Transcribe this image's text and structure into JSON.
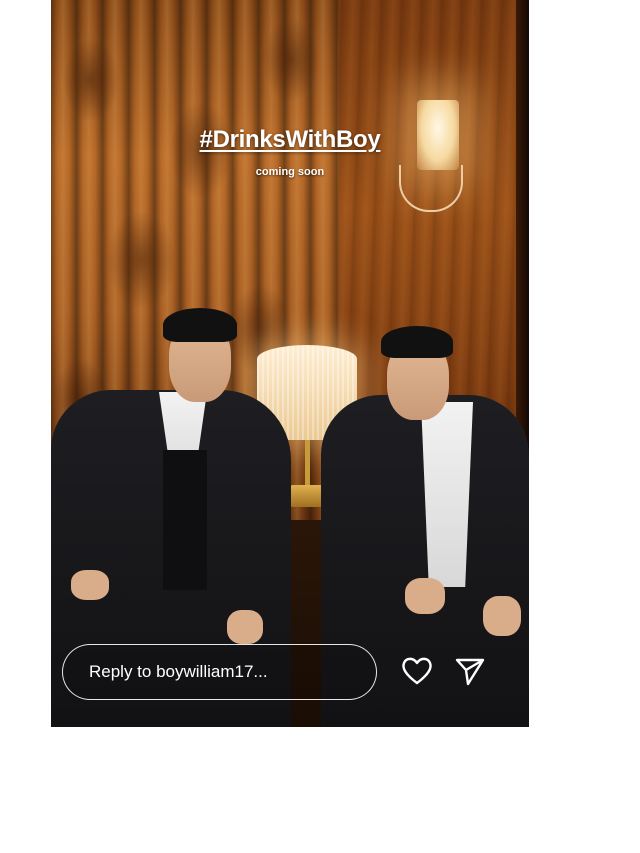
{
  "story": {
    "headline": "#DrinksWithBoy",
    "subtitle": "coming soon"
  },
  "reply": {
    "placeholder": "Reply to boywilliam17..."
  },
  "actions": {
    "like_icon": "heart-outline-icon",
    "send_icon": "paper-plane-icon"
  },
  "colors": {
    "overlay_text": "#ffffff",
    "page_background": "#ffffff"
  }
}
